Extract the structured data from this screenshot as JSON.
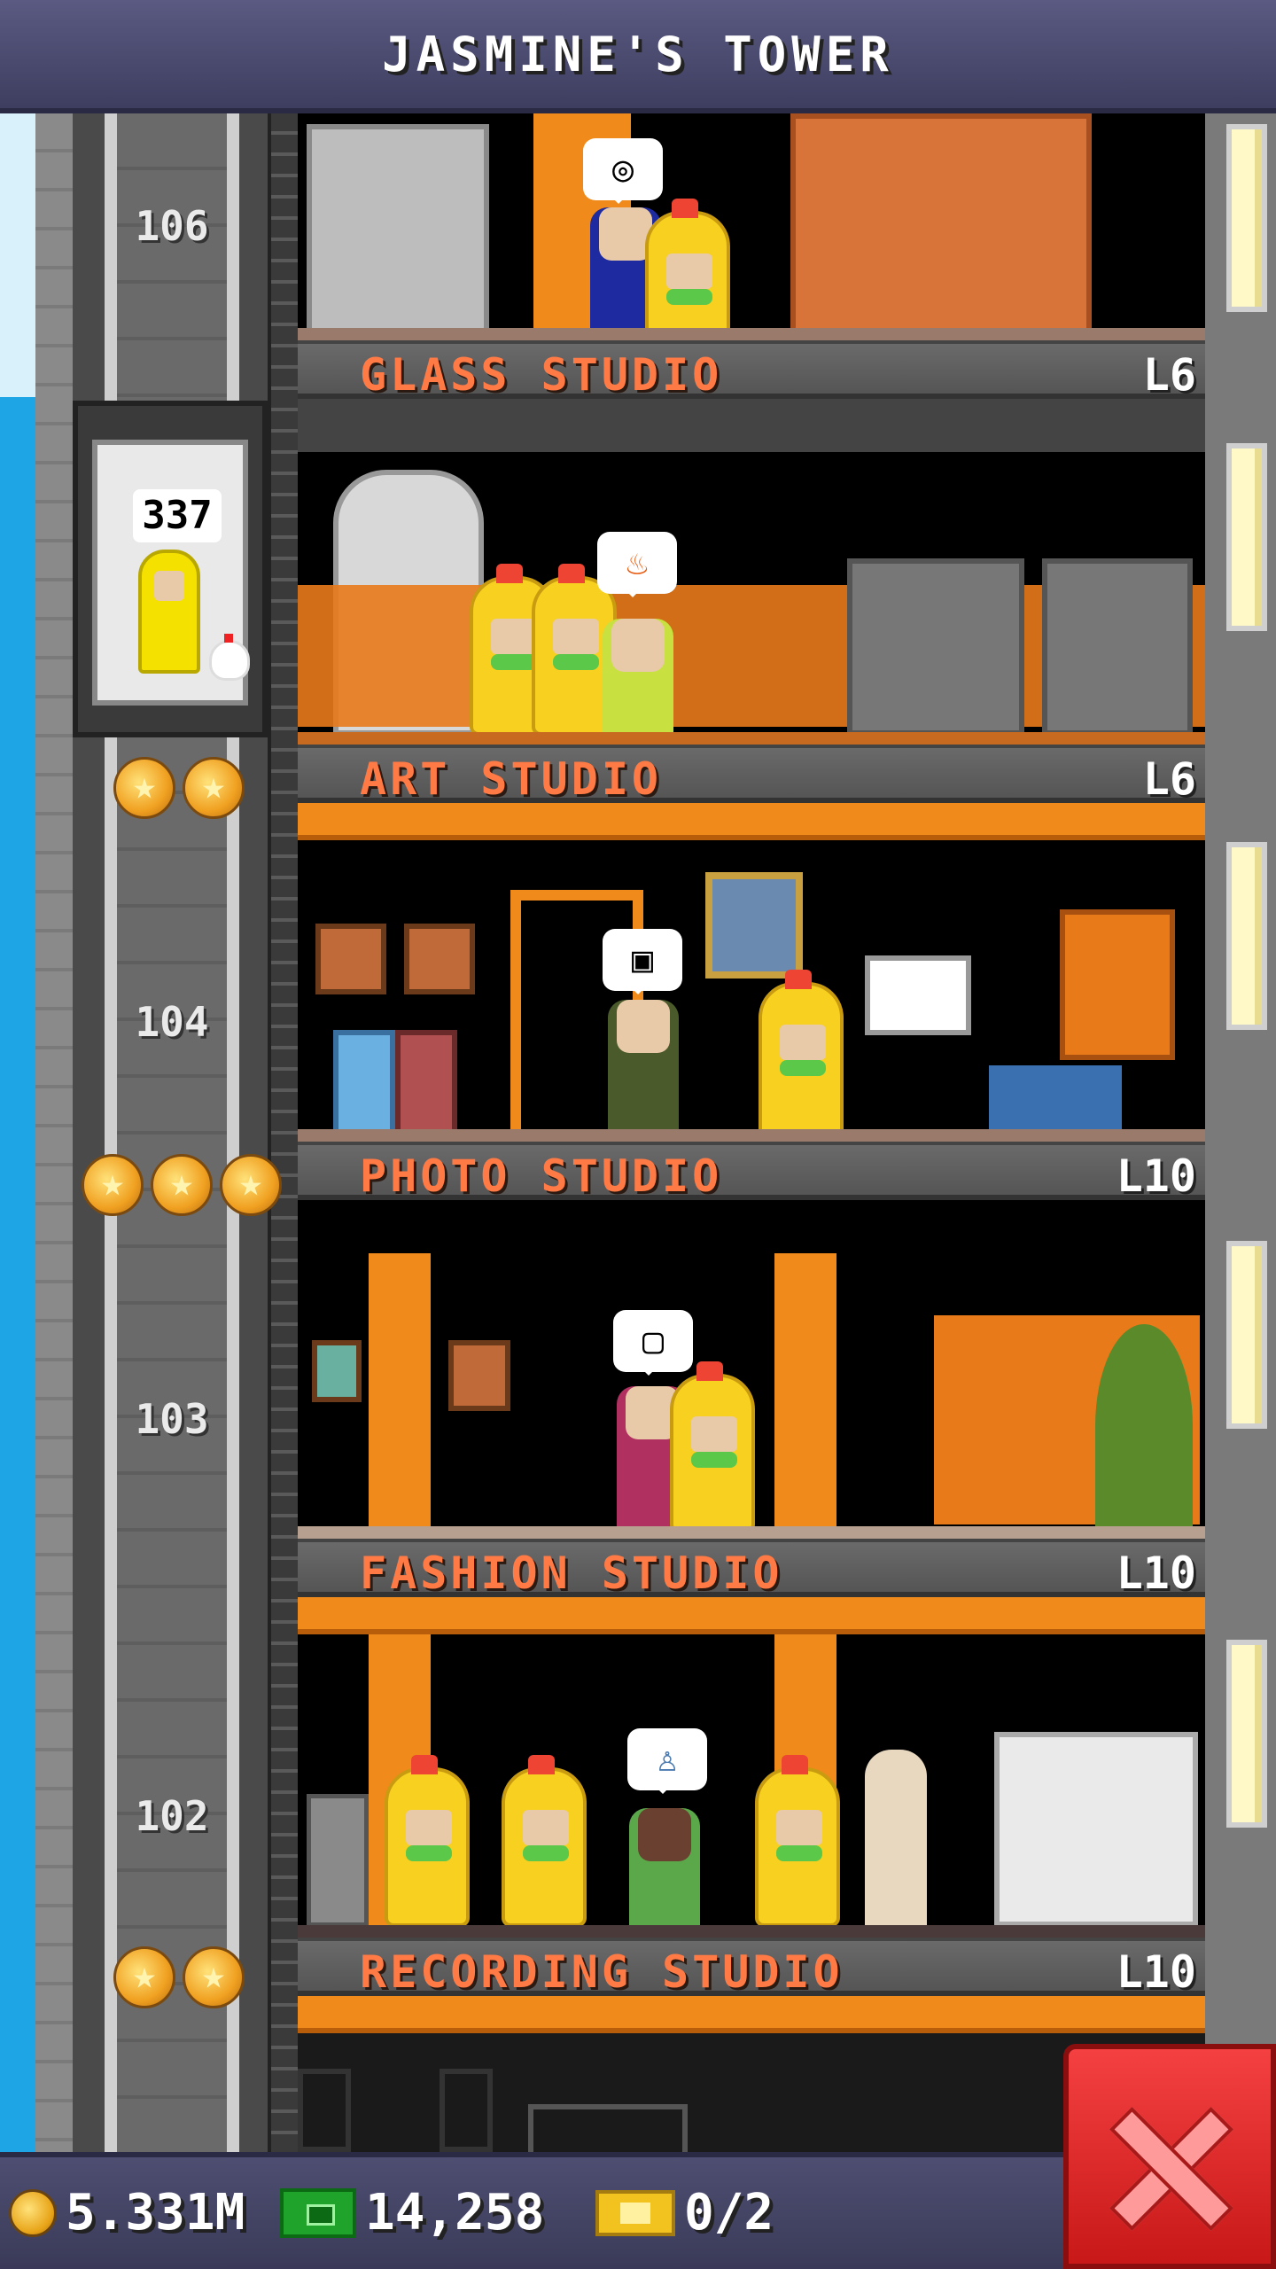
{
  "header": {
    "title": "JASMINE'S TOWER"
  },
  "elevator": {
    "passenger_count": "337"
  },
  "shaft_floor_numbers": [
    "106",
    "104",
    "103",
    "102"
  ],
  "floors": [
    {
      "name": "GLASS STUDIO",
      "level": "L6",
      "bubble_icon": "swirl-icon"
    },
    {
      "name": "ART STUDIO",
      "level": "L6",
      "bubble_icon": "flame-icon"
    },
    {
      "name": "PHOTO STUDIO",
      "level": "L10",
      "bubble_icon": "frame-icon"
    },
    {
      "name": "FASHION STUDIO",
      "level": "L10",
      "bubble_icon": "photo-icon"
    },
    {
      "name": "RECORDING STUDIO",
      "level": "L10",
      "bubble_icon": "figurine-icon"
    }
  ],
  "stars": {
    "above_art": 2,
    "beside_photo": 3,
    "beside_recording": 2
  },
  "status_bar": {
    "coins": "5.331M",
    "bux": "14,258",
    "tickets": "0/2"
  },
  "colors": {
    "floor_name": "#ff7a45",
    "accent_orange": "#f08a1a",
    "close_button": "#e02828",
    "sky": "#1ea5e6"
  },
  "icons": [
    "coin-icon",
    "bux-icon",
    "ticket-icon",
    "close-icon",
    "star-icon"
  ]
}
